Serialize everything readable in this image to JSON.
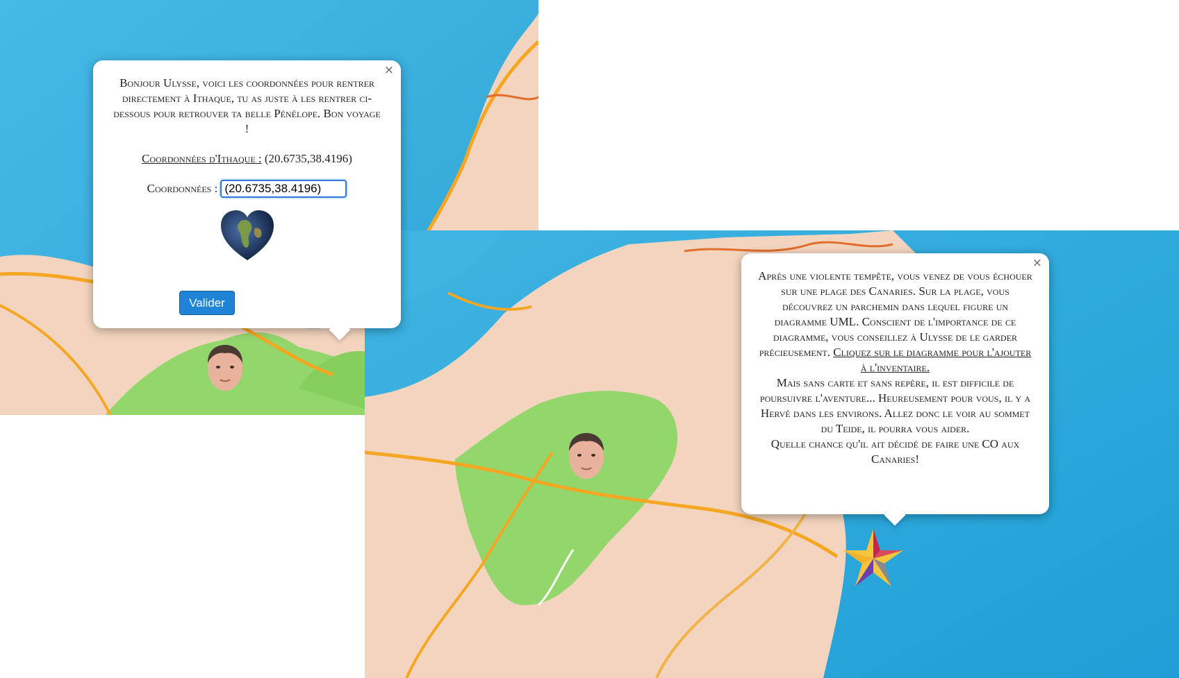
{
  "popup_ithaque": {
    "message": "Bonjour Ulysse, voici les coordonnées pour rentrer directement à Ithaque, tu as juste à les rentrer ci-dessous pour retrouver ta belle Pénélope. Bon voyage !",
    "coords_label": "Coordonnées d'Ithaque :",
    "coords_value": "(20.6735,38.4196)",
    "field_label": "Coordonnées :",
    "field_value": "(20.6735,38.4196)",
    "submit_label": "Valider",
    "close_label": "×"
  },
  "popup_canaries": {
    "message_part1": "Après une violente tempête, vous venez de vous échouer sur une plage des Canaries. Sur la plage, vous découvrez un parchemin dans lequel figure un diagramme UML. Conscient de l'importance de ce diagramme, vous conseillez à Ulysse de le garder précieusement.",
    "link_text": "Cliquez sur le diagramme pour l'ajouter à l'inventaire.",
    "message_part2": "Mais sans carte et sans repère, il est difficile de poursuivre l'aventure... Heureusement pour vous, il y a Hervé dans les environs. Allez donc le voir au sommet du Teide, il pourra vous aider.",
    "message_part3": "Quelle chance qu'il ait décidé de faire une CO aux Canaries!",
    "close_label": "×"
  },
  "colors": {
    "sea": "#3fb7e3",
    "land": "#f3d5bf",
    "forest": "#93d66c",
    "road": "#f5a623",
    "button": "#1f84d6"
  }
}
